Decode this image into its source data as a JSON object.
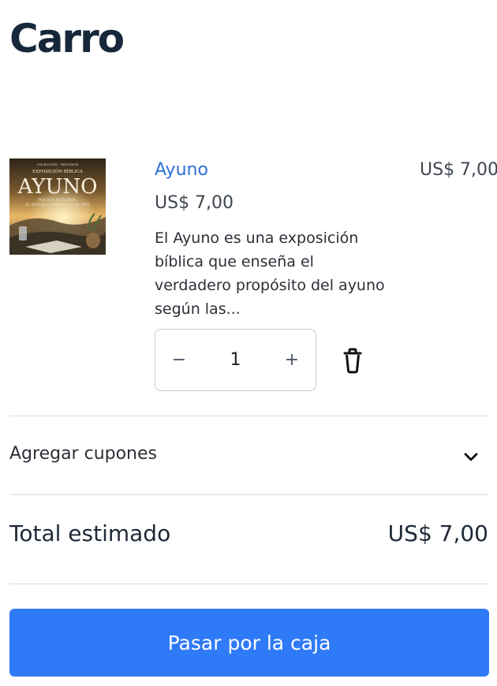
{
  "page": {
    "title": "Carro"
  },
  "cart_item": {
    "image_text": {
      "publisher_line": "COLECCIÓN · ESTUDIOS",
      "kicker": "EXPOSICIÓN BÍBLICA",
      "title": "AYUNO",
      "subtitle_line1": "POR QUÉ AYUNAMOS,",
      "subtitle_line2": "AL BUSCAR LA PRESENCIA DE DIOS"
    },
    "name": "Ayuno",
    "unit_price": "US$ 7,00",
    "line_total": "US$ 7,00",
    "description": "El Ayuno es una exposición bíblica que enseña el verdadero propósito del ayuno según las...",
    "quantity": "1",
    "minus_symbol": "−",
    "plus_symbol": "+",
    "icons": {
      "remove": "trash-icon"
    }
  },
  "coupons": {
    "label": "Agregar cupones",
    "icon": "chevron-down-icon"
  },
  "totals": {
    "label": "Total estimado",
    "value": "US$ 7,00"
  },
  "checkout": {
    "label": "Pasar por la caja"
  },
  "colors": {
    "accent": "#2f7af7",
    "link": "#2f6fd6",
    "title": "#17283b",
    "divider": "#d8dbe0"
  }
}
